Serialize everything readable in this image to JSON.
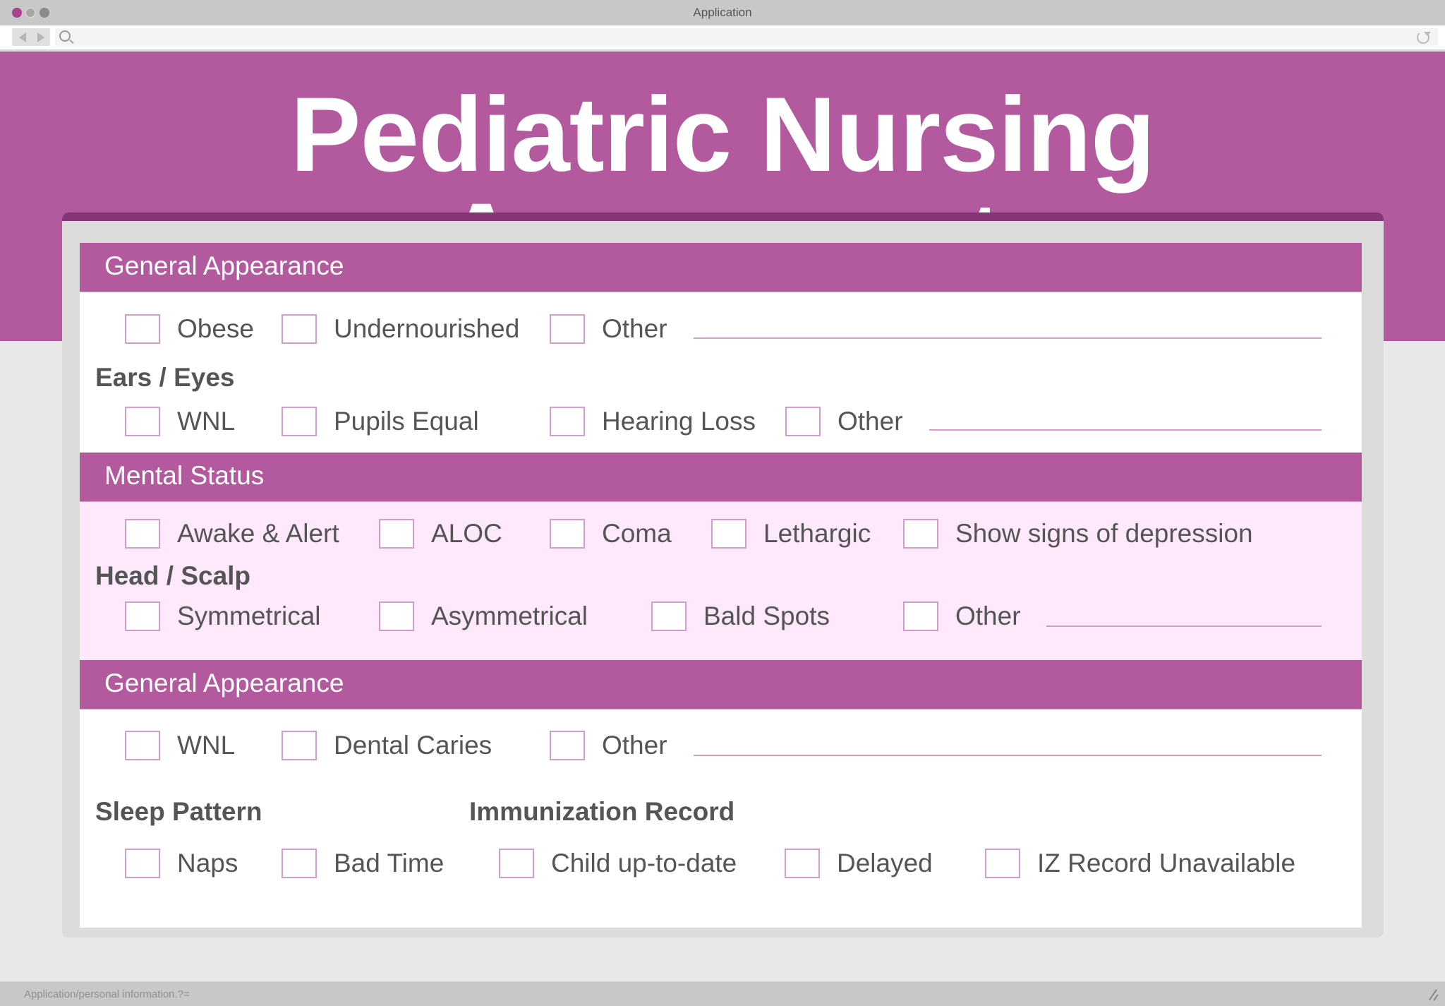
{
  "window": {
    "title": "Application",
    "status_text": "Application/personal information.?="
  },
  "page": {
    "title": "Pediatric Nursing Assesment"
  },
  "colors": {
    "brand": "#b35a9f",
    "brand_dark": "#843575",
    "pink_section": "#fde8fc",
    "checkbox_border": "#d29ccb"
  },
  "sections": {
    "general_appearance_1": {
      "header": "General Appearance",
      "options": [
        "Obese",
        "Undernourished",
        "Other"
      ]
    },
    "ears_eyes": {
      "label": "Ears / Eyes",
      "options": [
        "WNL",
        "Pupils Equal",
        "Hearing Loss",
        "Other"
      ]
    },
    "mental_status": {
      "header": "Mental Status",
      "options": [
        "Awake & Alert",
        "ALOC",
        "Coma",
        "Lethargic",
        "Show signs of depression"
      ]
    },
    "head_scalp": {
      "label": "Head / Scalp",
      "options": [
        "Symmetrical",
        "Asymmetrical",
        "Bald Spots",
        "Other"
      ]
    },
    "general_appearance_2": {
      "header": "General Appearance",
      "options": [
        "WNL",
        "Dental Caries",
        "Other"
      ]
    },
    "sleep_pattern": {
      "label": "Sleep Pattern",
      "options": [
        "Naps",
        "Bad Time"
      ]
    },
    "immunization_record": {
      "label": "Immunization Record",
      "options": [
        "Child up-to-date",
        "Delayed",
        "IZ Record Unavailable"
      ]
    }
  }
}
